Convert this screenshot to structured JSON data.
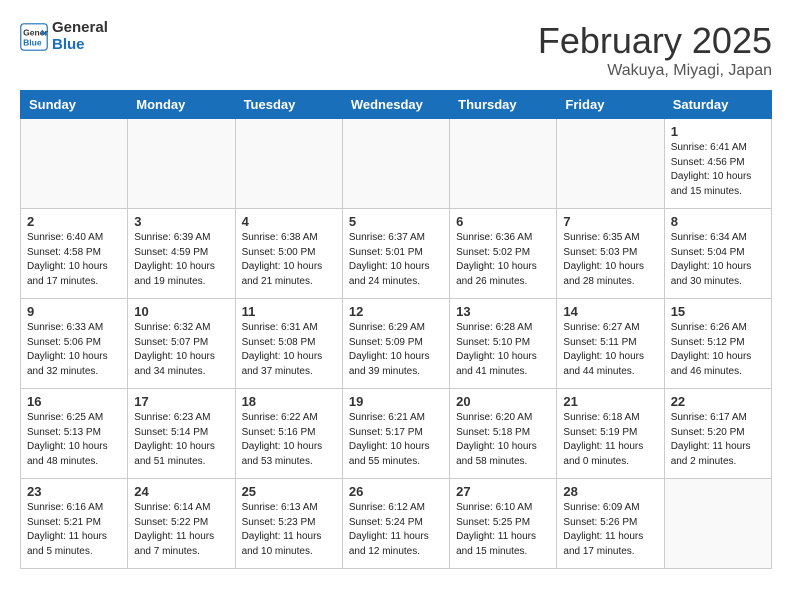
{
  "header": {
    "logo_line1": "General",
    "logo_line2": "Blue",
    "title": "February 2025",
    "subtitle": "Wakuya, Miyagi, Japan"
  },
  "days_of_week": [
    "Sunday",
    "Monday",
    "Tuesday",
    "Wednesday",
    "Thursday",
    "Friday",
    "Saturday"
  ],
  "weeks": [
    [
      {
        "day": "",
        "info": ""
      },
      {
        "day": "",
        "info": ""
      },
      {
        "day": "",
        "info": ""
      },
      {
        "day": "",
        "info": ""
      },
      {
        "day": "",
        "info": ""
      },
      {
        "day": "",
        "info": ""
      },
      {
        "day": "1",
        "info": "Sunrise: 6:41 AM\nSunset: 4:56 PM\nDaylight: 10 hours\nand 15 minutes."
      }
    ],
    [
      {
        "day": "2",
        "info": "Sunrise: 6:40 AM\nSunset: 4:58 PM\nDaylight: 10 hours\nand 17 minutes."
      },
      {
        "day": "3",
        "info": "Sunrise: 6:39 AM\nSunset: 4:59 PM\nDaylight: 10 hours\nand 19 minutes."
      },
      {
        "day": "4",
        "info": "Sunrise: 6:38 AM\nSunset: 5:00 PM\nDaylight: 10 hours\nand 21 minutes."
      },
      {
        "day": "5",
        "info": "Sunrise: 6:37 AM\nSunset: 5:01 PM\nDaylight: 10 hours\nand 24 minutes."
      },
      {
        "day": "6",
        "info": "Sunrise: 6:36 AM\nSunset: 5:02 PM\nDaylight: 10 hours\nand 26 minutes."
      },
      {
        "day": "7",
        "info": "Sunrise: 6:35 AM\nSunset: 5:03 PM\nDaylight: 10 hours\nand 28 minutes."
      },
      {
        "day": "8",
        "info": "Sunrise: 6:34 AM\nSunset: 5:04 PM\nDaylight: 10 hours\nand 30 minutes."
      }
    ],
    [
      {
        "day": "9",
        "info": "Sunrise: 6:33 AM\nSunset: 5:06 PM\nDaylight: 10 hours\nand 32 minutes."
      },
      {
        "day": "10",
        "info": "Sunrise: 6:32 AM\nSunset: 5:07 PM\nDaylight: 10 hours\nand 34 minutes."
      },
      {
        "day": "11",
        "info": "Sunrise: 6:31 AM\nSunset: 5:08 PM\nDaylight: 10 hours\nand 37 minutes."
      },
      {
        "day": "12",
        "info": "Sunrise: 6:29 AM\nSunset: 5:09 PM\nDaylight: 10 hours\nand 39 minutes."
      },
      {
        "day": "13",
        "info": "Sunrise: 6:28 AM\nSunset: 5:10 PM\nDaylight: 10 hours\nand 41 minutes."
      },
      {
        "day": "14",
        "info": "Sunrise: 6:27 AM\nSunset: 5:11 PM\nDaylight: 10 hours\nand 44 minutes."
      },
      {
        "day": "15",
        "info": "Sunrise: 6:26 AM\nSunset: 5:12 PM\nDaylight: 10 hours\nand 46 minutes."
      }
    ],
    [
      {
        "day": "16",
        "info": "Sunrise: 6:25 AM\nSunset: 5:13 PM\nDaylight: 10 hours\nand 48 minutes."
      },
      {
        "day": "17",
        "info": "Sunrise: 6:23 AM\nSunset: 5:14 PM\nDaylight: 10 hours\nand 51 minutes."
      },
      {
        "day": "18",
        "info": "Sunrise: 6:22 AM\nSunset: 5:16 PM\nDaylight: 10 hours\nand 53 minutes."
      },
      {
        "day": "19",
        "info": "Sunrise: 6:21 AM\nSunset: 5:17 PM\nDaylight: 10 hours\nand 55 minutes."
      },
      {
        "day": "20",
        "info": "Sunrise: 6:20 AM\nSunset: 5:18 PM\nDaylight: 10 hours\nand 58 minutes."
      },
      {
        "day": "21",
        "info": "Sunrise: 6:18 AM\nSunset: 5:19 PM\nDaylight: 11 hours\nand 0 minutes."
      },
      {
        "day": "22",
        "info": "Sunrise: 6:17 AM\nSunset: 5:20 PM\nDaylight: 11 hours\nand 2 minutes."
      }
    ],
    [
      {
        "day": "23",
        "info": "Sunrise: 6:16 AM\nSunset: 5:21 PM\nDaylight: 11 hours\nand 5 minutes."
      },
      {
        "day": "24",
        "info": "Sunrise: 6:14 AM\nSunset: 5:22 PM\nDaylight: 11 hours\nand 7 minutes."
      },
      {
        "day": "25",
        "info": "Sunrise: 6:13 AM\nSunset: 5:23 PM\nDaylight: 11 hours\nand 10 minutes."
      },
      {
        "day": "26",
        "info": "Sunrise: 6:12 AM\nSunset: 5:24 PM\nDaylight: 11 hours\nand 12 minutes."
      },
      {
        "day": "27",
        "info": "Sunrise: 6:10 AM\nSunset: 5:25 PM\nDaylight: 11 hours\nand 15 minutes."
      },
      {
        "day": "28",
        "info": "Sunrise: 6:09 AM\nSunset: 5:26 PM\nDaylight: 11 hours\nand 17 minutes."
      },
      {
        "day": "",
        "info": ""
      }
    ]
  ]
}
